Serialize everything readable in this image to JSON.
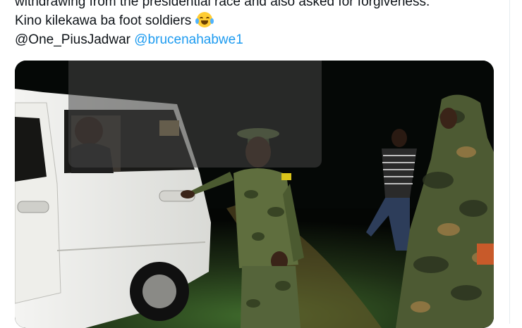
{
  "tweet": {
    "line1": "withdrawing from the presidential race and also asked for forgiveness.",
    "line2": "Kino kilekawa ba foot soldiers",
    "emoji": "face-with-tears-of-joy",
    "mention_author": "@One_PiusJadwar",
    "mention_link": "@brucenahabwe1"
  },
  "colors": {
    "text": "#0f1419",
    "link": "#1d9bf0"
  },
  "media": {
    "description_icon": "photo"
  }
}
